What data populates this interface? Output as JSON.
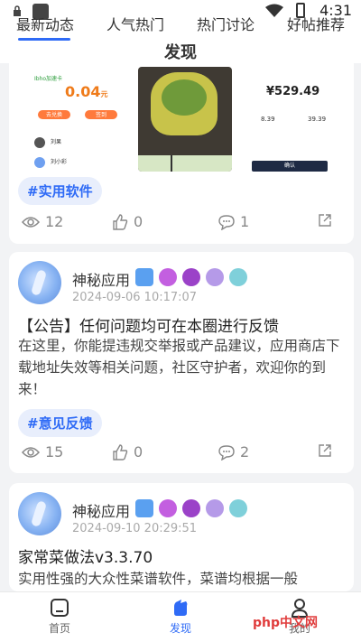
{
  "status": {
    "time": "4:31"
  },
  "tabs": [
    {
      "label": "最新动态",
      "active": true
    },
    {
      "label": "人气热门",
      "active": false
    },
    {
      "label": "热门讨论",
      "active": false
    },
    {
      "label": "好帖推荐",
      "active": false
    }
  ],
  "page_title": "发现",
  "posts": [
    {
      "thumb1": {
        "brand": "Ibho加速卡",
        "amount": "0.04",
        "unit": "元",
        "btn1": "去兑换",
        "btn2": "签到",
        "name1": "刘果",
        "name2": "刘小彩"
      },
      "thumb3": {
        "price": "¥529.49",
        "v1": "8.39",
        "v2": "39.39",
        "btn": "确认"
      },
      "tag": "#实用软件",
      "views": "12",
      "likes": "0",
      "comments": "1"
    },
    {
      "author": "神秘应用",
      "date": "2024-09-06 10:17:07",
      "title": "【公告】任何问题均可在本圈进行反馈",
      "body": "在这里，你能提违规交举报或产品建议，应用商店下载地址失效等相关问题，社区守护者，欢迎你的到来！",
      "tag": "#意见反馈",
      "views": "15",
      "likes": "0",
      "comments": "2"
    },
    {
      "author": "神秘应用",
      "date": "2024-09-10 20:29:51",
      "title": "家常菜做法v3.3.70",
      "body": "实用性强的大众性菜谱软件，菜谱均根据一般"
    }
  ],
  "nav": [
    {
      "label": "首页"
    },
    {
      "label": "发现"
    },
    {
      "label": "我的"
    }
  ],
  "watermark": "php中文网",
  "colors": {
    "accent": "#2f6bf6",
    "tag_bg": "#e8eefc",
    "page_bg": "#f2f3f5"
  }
}
